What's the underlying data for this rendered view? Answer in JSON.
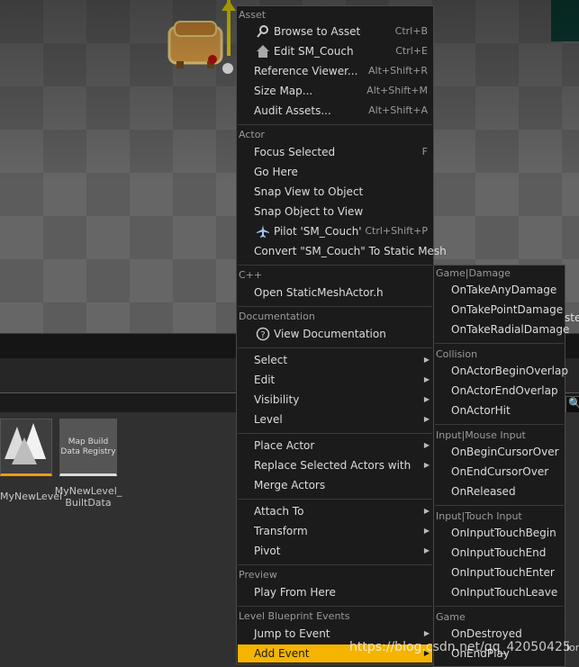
{
  "viewport": {
    "right_text": "ste"
  },
  "search_glyph": "🔍",
  "assets": [
    {
      "label": "MyNewLevel",
      "thumb_text": ""
    },
    {
      "label": "MyNewLevel_\nBuiltData",
      "thumb_text": "Map Build\nData Registry"
    }
  ],
  "right_panel_text": "ion",
  "menu": {
    "asset_header": "Asset",
    "browse": {
      "label": "Browse to Asset",
      "shortcut": "Ctrl+B",
      "icon": "search-icon"
    },
    "edit": {
      "label": "Edit SM_Couch",
      "shortcut": "Ctrl+E",
      "icon": "home-icon"
    },
    "reference_viewer": {
      "label": "Reference Viewer...",
      "shortcut": "Alt+Shift+R"
    },
    "size_map": {
      "label": "Size Map...",
      "shortcut": "Alt+Shift+M"
    },
    "audit": {
      "label": "Audit Assets...",
      "shortcut": "Alt+Shift+A"
    },
    "actor_header": "Actor",
    "focus": {
      "label": "Focus Selected",
      "shortcut": "F"
    },
    "go_here": {
      "label": "Go Here"
    },
    "snap_view": {
      "label": "Snap View to Object"
    },
    "snap_object": {
      "label": "Snap Object to View"
    },
    "pilot": {
      "label": "Pilot 'SM_Couch'",
      "shortcut": "Ctrl+Shift+P",
      "icon": "airplane-icon"
    },
    "convert": {
      "label": "Convert \"SM_Couch\" To Static Mesh"
    },
    "cpp_header": "C++",
    "open_cpp": {
      "label": "Open StaticMeshActor.h"
    },
    "doc_header": "Documentation",
    "view_doc": {
      "label": "View Documentation",
      "icon": "help-icon"
    },
    "select": "Select",
    "edit_sub": "Edit",
    "visibility": "Visibility",
    "level": "Level",
    "place_actor": "Place Actor",
    "replace": "Replace Selected Actors with",
    "merge": "Merge Actors",
    "attach": "Attach To",
    "transform": "Transform",
    "pivot": "Pivot",
    "preview_header": "Preview",
    "play_from_here": "Play From Here",
    "lbe_header": "Level Blueprint Events",
    "jump": "Jump to Event",
    "add_event": "Add Event"
  },
  "submenu": {
    "game_damage_header": "Game|Damage",
    "take_any": "OnTakeAnyDamage",
    "take_point": "OnTakePointDamage",
    "take_radial": "OnTakeRadialDamage",
    "collision_header": "Collision",
    "begin_overlap": "OnActorBeginOverlap",
    "end_overlap": "OnActorEndOverlap",
    "actor_hit": "OnActorHit",
    "mouse_header": "Input|Mouse Input",
    "begin_cursor": "OnBeginCursorOver",
    "end_cursor": "OnEndCursorOver",
    "released": "OnReleased",
    "touch_header": "Input|Touch Input",
    "touch_begin": "OnInputTouchBegin",
    "touch_end": "OnInputTouchEnd",
    "touch_enter": "OnInputTouchEnter",
    "touch_leave": "OnInputTouchLeave",
    "game_header": "Game",
    "destroyed": "OnDestroyed",
    "end_play": "OnEndPlay"
  },
  "watermark": "https://blog.csdn.net/qq_42050425",
  "colors": {
    "highlight": "#f4b400",
    "menu_bg": "#1b1b1b",
    "gizmo": "#f2e200"
  }
}
